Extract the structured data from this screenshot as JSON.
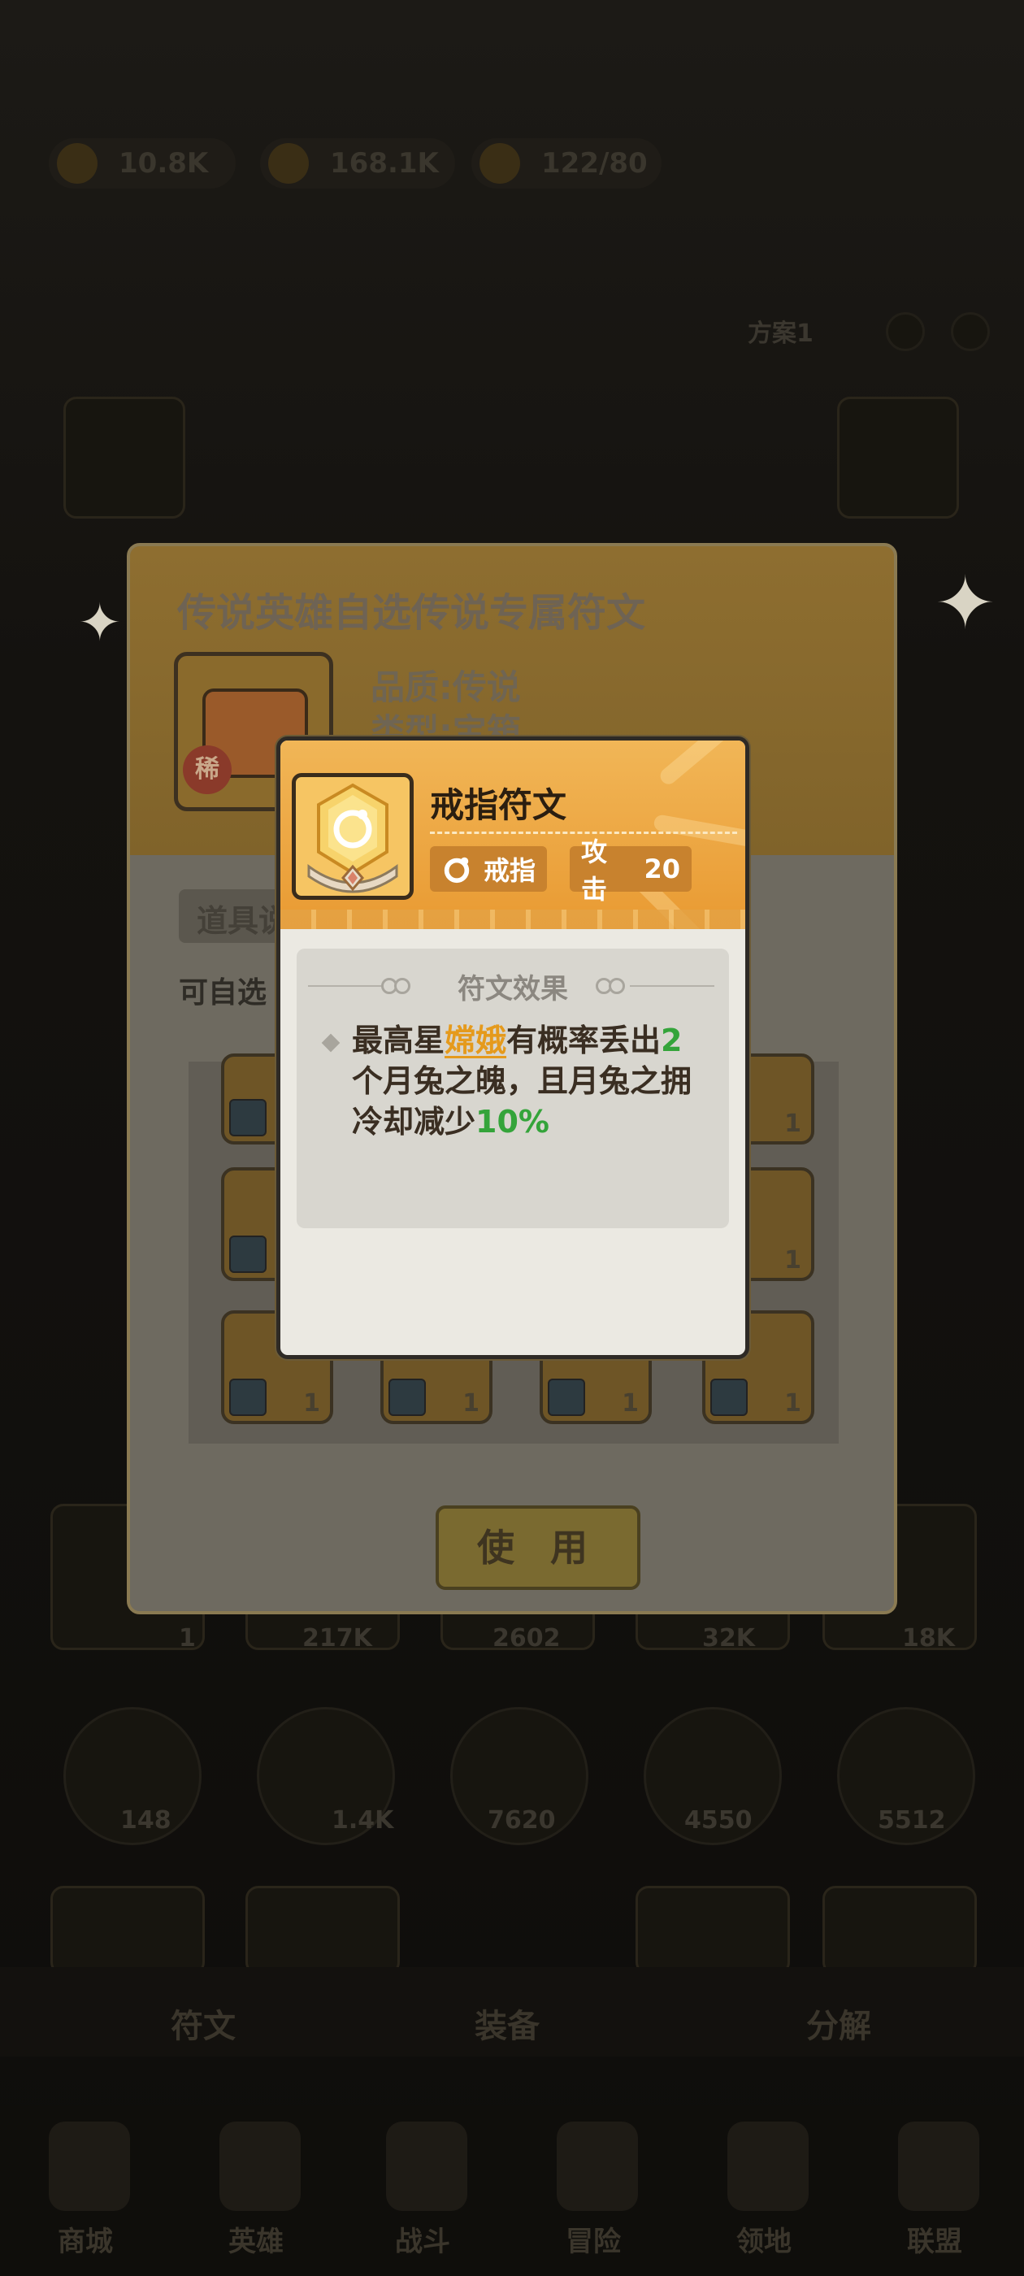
{
  "background": {
    "resources": [
      "10.8K",
      "168.1K",
      "122/80"
    ],
    "side_label": "方案1",
    "bottom_values": [
      "1",
      "217K",
      "2602",
      "32K",
      "18K"
    ],
    "circle_values": [
      "148",
      "1.4K",
      "7620",
      "4550",
      "5512"
    ],
    "tabs": [
      "符文",
      "装备",
      "分解"
    ],
    "nav": [
      "商城",
      "英雄",
      "战斗",
      "冒险",
      "领地",
      "联盟"
    ]
  },
  "outer_dialog": {
    "title": "传说英雄自选传说专属符文",
    "rarity_badge": "稀",
    "quality": "品质:传说",
    "type": "类型:宝箱",
    "section_label": "道具说",
    "description": "可自选",
    "grid_count": "1",
    "use_button": "使 用"
  },
  "popup": {
    "title": "戒指符文",
    "category": "戒指",
    "stat_label": "攻击",
    "stat_value": "20",
    "effect_header": "符文效果",
    "effect": {
      "part1": "最高星",
      "hero": "嫦娥",
      "part2": "有概率丢出",
      "count": "2",
      "part3": "个月兔之魄，且月兔之拥冷却减少",
      "percent": "10%"
    }
  },
  "colors": {
    "header_orange": "#e99a32",
    "highlight_gold": "#e59a1c",
    "highlight_green": "#34a43a",
    "popup_bg": "#ebe9e2"
  }
}
